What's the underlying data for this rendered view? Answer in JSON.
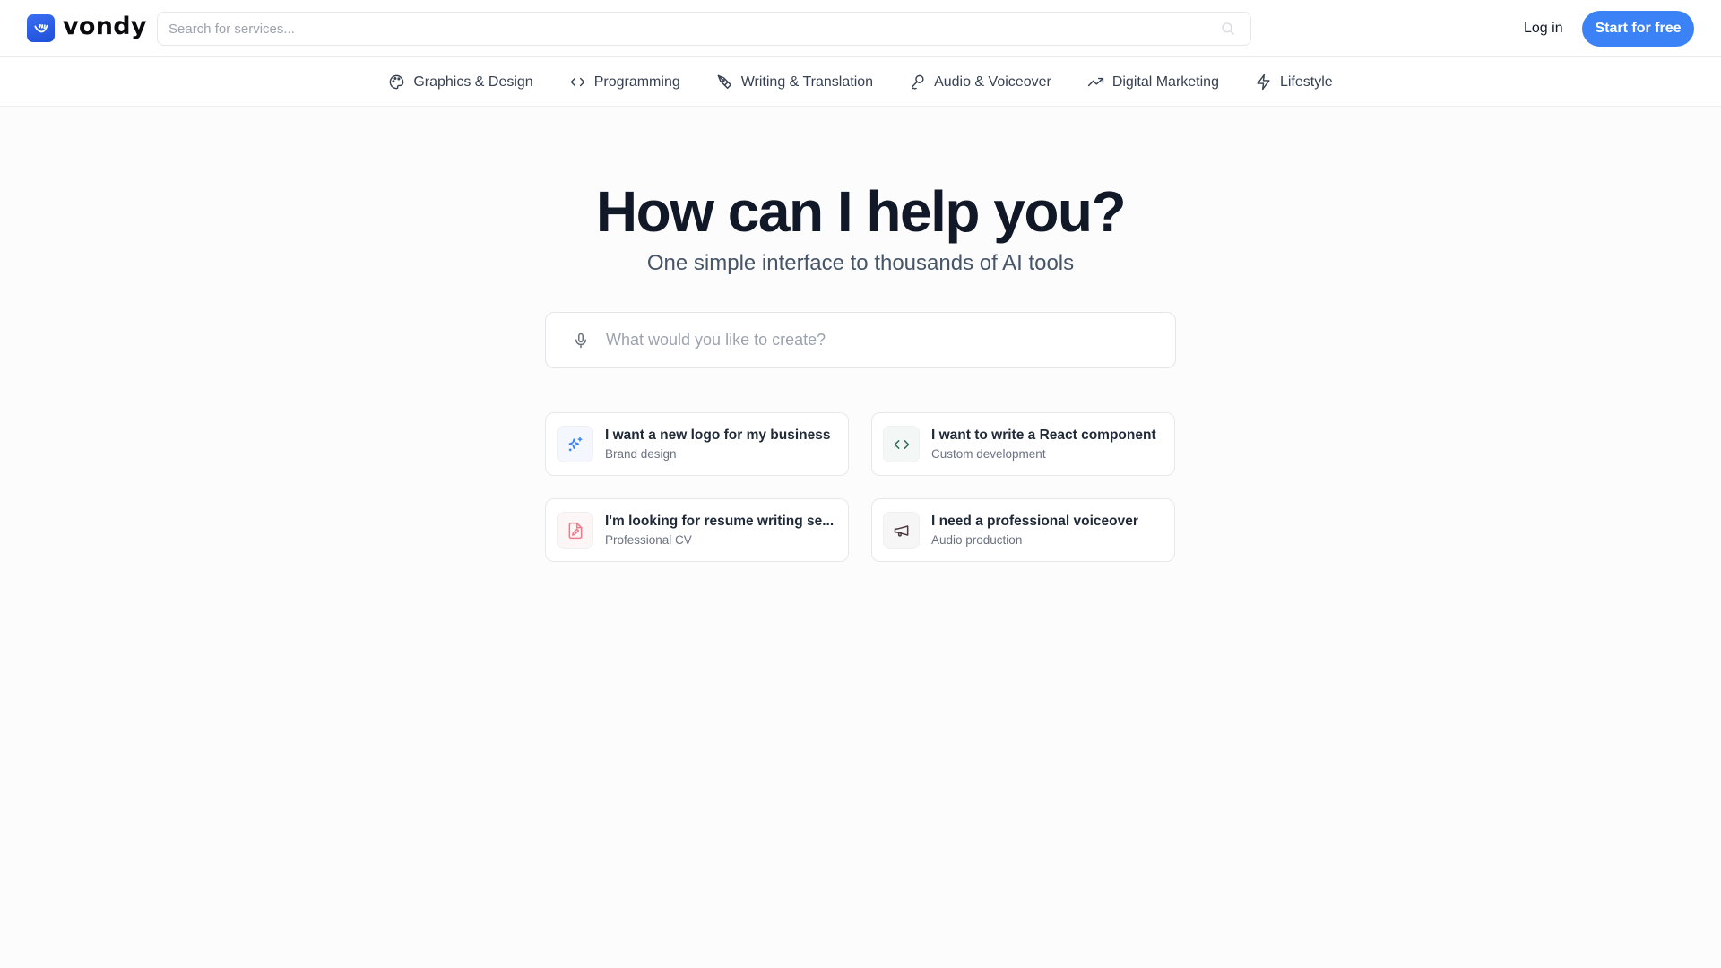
{
  "header": {
    "brand": "vondy",
    "search_placeholder": "Search for services...",
    "login_label": "Log in",
    "cta_label": "Start for free",
    "accent": "#3b82f6"
  },
  "categories": [
    {
      "label": "Graphics & Design",
      "icon": "palette-icon"
    },
    {
      "label": "Programming",
      "icon": "code-icon"
    },
    {
      "label": "Writing & Translation",
      "icon": "pen-tool-icon"
    },
    {
      "label": "Audio & Voiceover",
      "icon": "microphone-icon"
    },
    {
      "label": "Digital Marketing",
      "icon": "trending-up-icon"
    },
    {
      "label": "Lifestyle",
      "icon": "lightning-icon"
    }
  ],
  "hero": {
    "title": "How can I help you?",
    "subtitle": "One simple interface to thousands of AI tools",
    "input_placeholder": "What would you like to create?"
  },
  "suggestions": [
    {
      "title": "I want a new logo for my business",
      "subtitle": "Brand design",
      "icon": "sparkles-icon",
      "color": "#3b82f6"
    },
    {
      "title": "I want to write a React component",
      "subtitle": "Custom development",
      "icon": "code-icon",
      "color": "#2f6b5e"
    },
    {
      "title": "I'm looking for resume writing se...",
      "subtitle": "Professional CV",
      "icon": "file-edit-icon",
      "color": "#f07a8a"
    },
    {
      "title": "I need a professional voiceover",
      "subtitle": "Audio production",
      "icon": "megaphone-icon",
      "color": "#4a3a40"
    }
  ]
}
